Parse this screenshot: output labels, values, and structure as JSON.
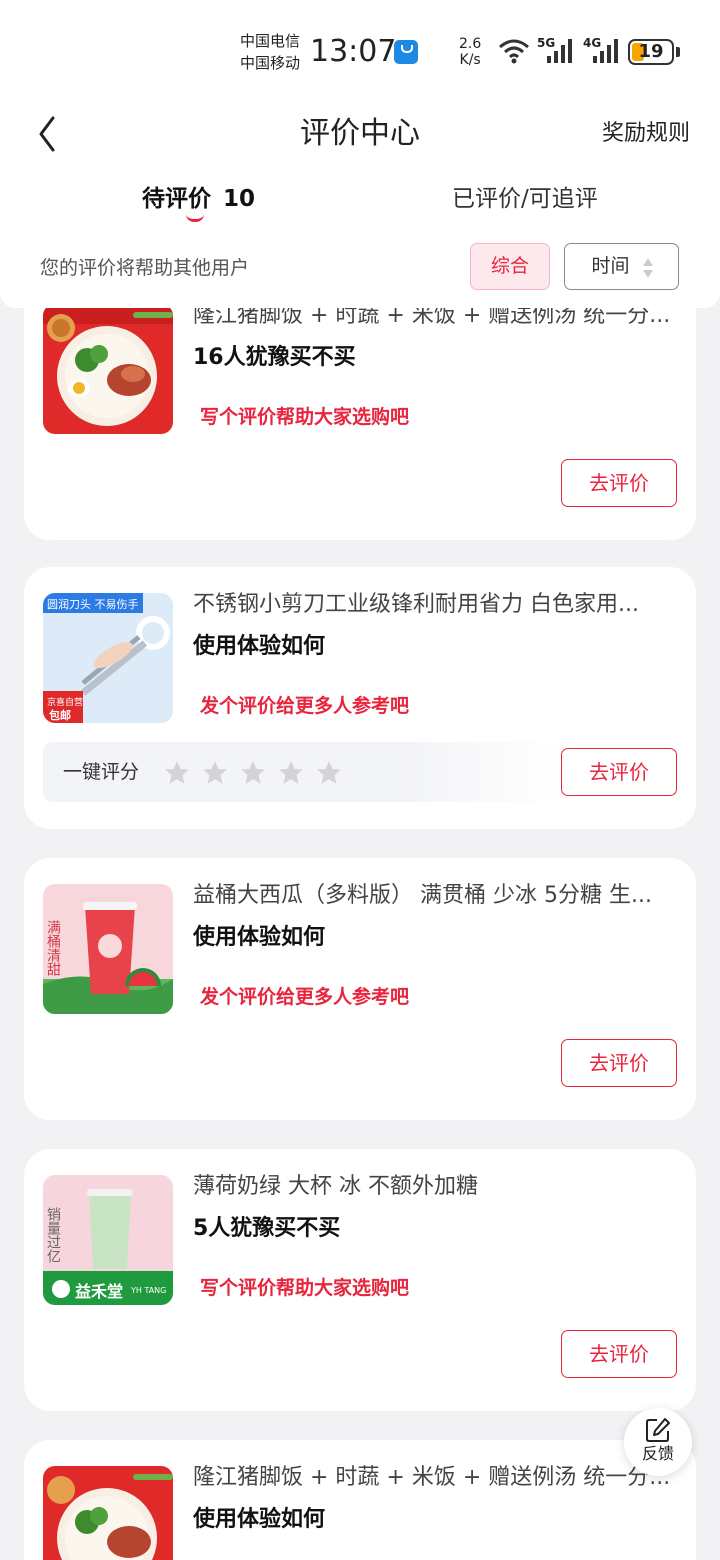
{
  "status_bar": {
    "carrier_1": "中国电信",
    "carrier_2": "中国移动",
    "time": "13:07",
    "net_speed_value": "2.6",
    "net_speed_unit": "K/s",
    "signal_1": "5G",
    "signal_2": "4G",
    "battery": "19"
  },
  "header": {
    "title": "评价中心",
    "rules": "奖励规则",
    "tabs": [
      {
        "label": "待评价",
        "count": "10"
      },
      {
        "label": "已评价/可追评"
      }
    ],
    "hint": "您的评价将帮助其他用户",
    "sort_combo": "综合",
    "sort_time": "时间"
  },
  "products": [
    {
      "name": "隆江猪脚饭 + 时蔬 + 米饭 + 赠送例汤 统一分...",
      "sub": "16人犹豫买不买",
      "prompt": "写个评价帮助大家选购吧",
      "button": "去评价"
    },
    {
      "name": "不锈钢小剪刀工业级锋利耐用省力 白色家用...",
      "sub": "使用体验如何",
      "prompt": "发个评价给更多人参考吧",
      "button": "去评价",
      "rating_label": "一键评分",
      "thumb_tag": "圆润刀头 不易伤手",
      "thumb_badge_1": "京喜自营",
      "thumb_badge_2": "包邮"
    },
    {
      "name": "益桶大西瓜（多料版） 满贯桶 少冰 5分糖 生...",
      "sub": "使用体验如何",
      "prompt": "发个评价给更多人参考吧",
      "button": "去评价",
      "thumb_text": "满桶清甜"
    },
    {
      "name": "薄荷奶绿 大杯 冰 不额外加糖",
      "sub": "5人犹豫买不买",
      "prompt": "写个评价帮助大家选购吧",
      "button": "去评价",
      "thumb_text": "销量过亿",
      "thumb_brand": "益禾堂",
      "thumb_brand_en": "YH TANG"
    },
    {
      "name": "隆江猪脚饭 + 时蔬 + 米饭 + 赠送例汤 统一分...",
      "sub": "使用体验如何"
    }
  ],
  "feedback": "反馈",
  "colors": {
    "accent": "#e8253d",
    "page_bg": "#f2f2f4"
  }
}
